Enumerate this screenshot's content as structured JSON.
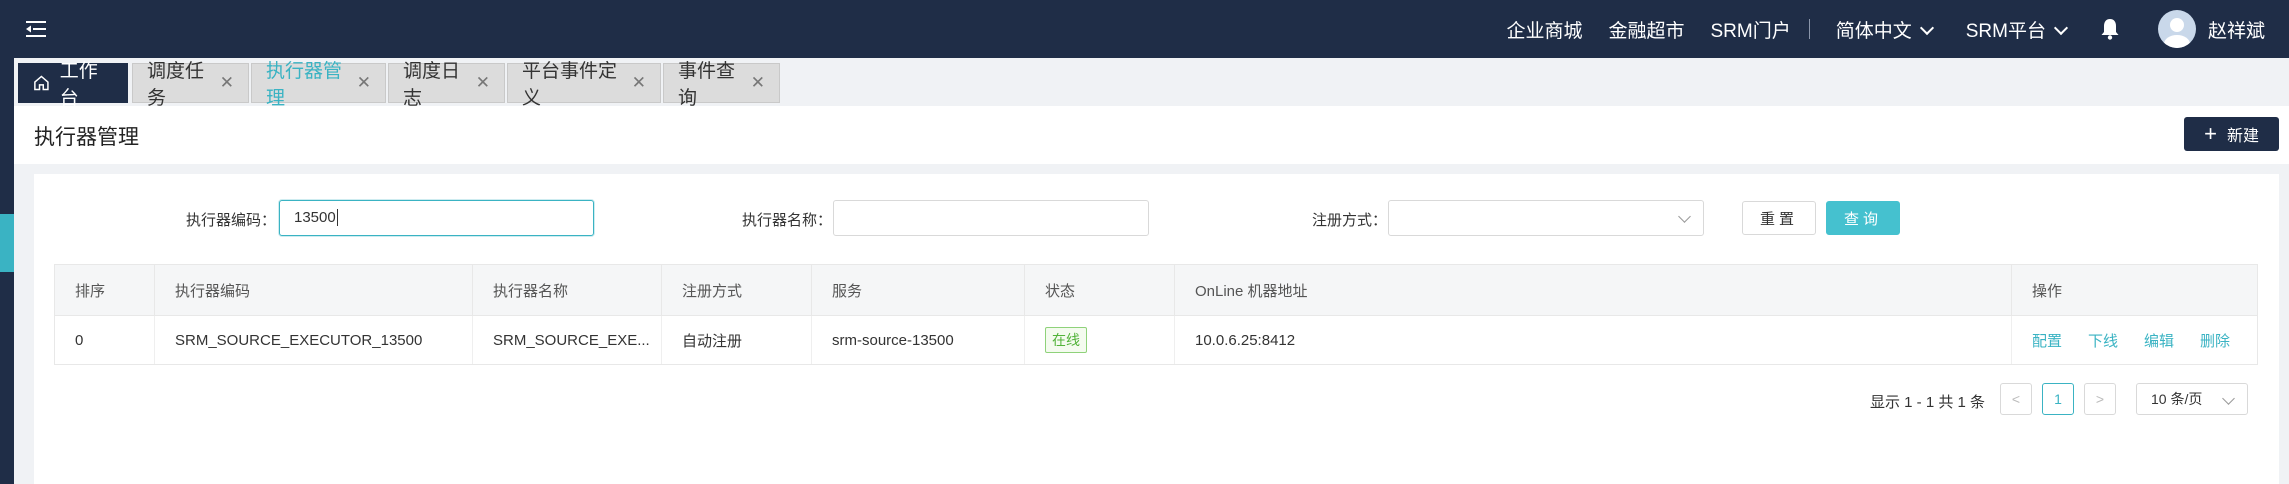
{
  "header": {
    "links": [
      "企业商城",
      "金融超市",
      "SRM门户"
    ],
    "language": "简体中文",
    "platform": "SRM平台",
    "user_name": "赵祥斌"
  },
  "tabs": [
    {
      "label": "工作台",
      "home": true
    },
    {
      "label": "调度任务"
    },
    {
      "label": "执行器管理",
      "active": true
    },
    {
      "label": "调度日志"
    },
    {
      "label": "平台事件定义"
    },
    {
      "label": "事件查询"
    }
  ],
  "page": {
    "title": "执行器管理",
    "new_button": "新建"
  },
  "filters": {
    "code_label": "执行器编码：",
    "code_value": "13500",
    "name_label": "执行器名称：",
    "name_value": "",
    "reg_label": "注册方式：",
    "reg_value": "",
    "reset_button": "重置",
    "query_button": "查询"
  },
  "table": {
    "columns": [
      "排序",
      "执行器编码",
      "执行器名称",
      "注册方式",
      "服务",
      "状态",
      "OnLine 机器地址",
      "操作"
    ],
    "rows": [
      {
        "order": "0",
        "code": "SRM_SOURCE_EXECUTOR_13500",
        "name": "SRM_SOURCE_EXE...",
        "reg": "自动注册",
        "service": "srm-source-13500",
        "status": "在线",
        "address": "10.0.6.25:8412",
        "actions": [
          "配置",
          "下线",
          "编辑",
          "删除"
        ]
      }
    ]
  },
  "pagination": {
    "summary": "显示 1 - 1 共 1 条",
    "current_page": "1",
    "prev": "<",
    "next": ">",
    "page_size": "10 条/页"
  },
  "colors": {
    "navy": "#1f2d47",
    "accent": "#3ab3c3",
    "status_green": "#52b33a"
  }
}
